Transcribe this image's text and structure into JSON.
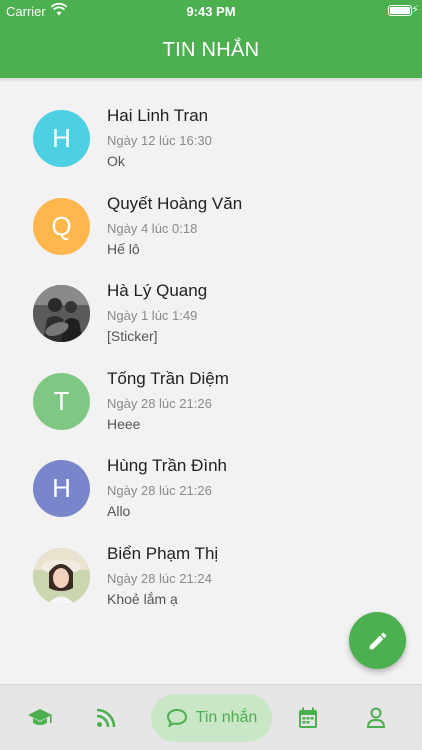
{
  "status_bar": {
    "carrier": "Carrier",
    "time": "9:43 PM"
  },
  "header": {
    "title": "TIN NHẮN"
  },
  "conversations": [
    {
      "initial": "H",
      "avatar_color": "#4dd0e1",
      "name": "Hai Linh Tran",
      "time": "Ngày 12 lúc 16:30",
      "message": "Ok"
    },
    {
      "initial": "Q",
      "avatar_color": "#ffb74d",
      "name": "Quyết Hoàng Văn",
      "time": "Ngày 4 lúc 0:18",
      "message": "Hế lô"
    },
    {
      "initial": "",
      "avatar_color": "#555555",
      "name": "Hà Lý Quang",
      "time": "Ngày 1 lúc 1:49",
      "message": "[Sticker]"
    },
    {
      "initial": "T",
      "avatar_color": "#81c784",
      "name": "Tống Trần Diệm",
      "time": "Ngày 28 lúc 21:26",
      "message": "Heee"
    },
    {
      "initial": "H",
      "avatar_color": "#7986cb",
      "name": "Hùng Trần Đình",
      "time": "Ngày 28 lúc 21:26",
      "message": "Allo"
    },
    {
      "initial": "",
      "avatar_color": "#d8c8a8",
      "name": "Biển Phạm Thị",
      "time": "Ngày 28 lúc 21:24",
      "message": "Khoẻ lắm ạ"
    }
  ],
  "bottom_nav": {
    "active_label": "Tin nhắn",
    "accent": "#4caf50",
    "items": [
      "graduation-cap-icon",
      "rss-icon",
      "chat-icon",
      "calendar-icon",
      "user-icon"
    ]
  },
  "colors": {
    "primary": "#4caf50",
    "active_pill": "#c9e6c6"
  }
}
